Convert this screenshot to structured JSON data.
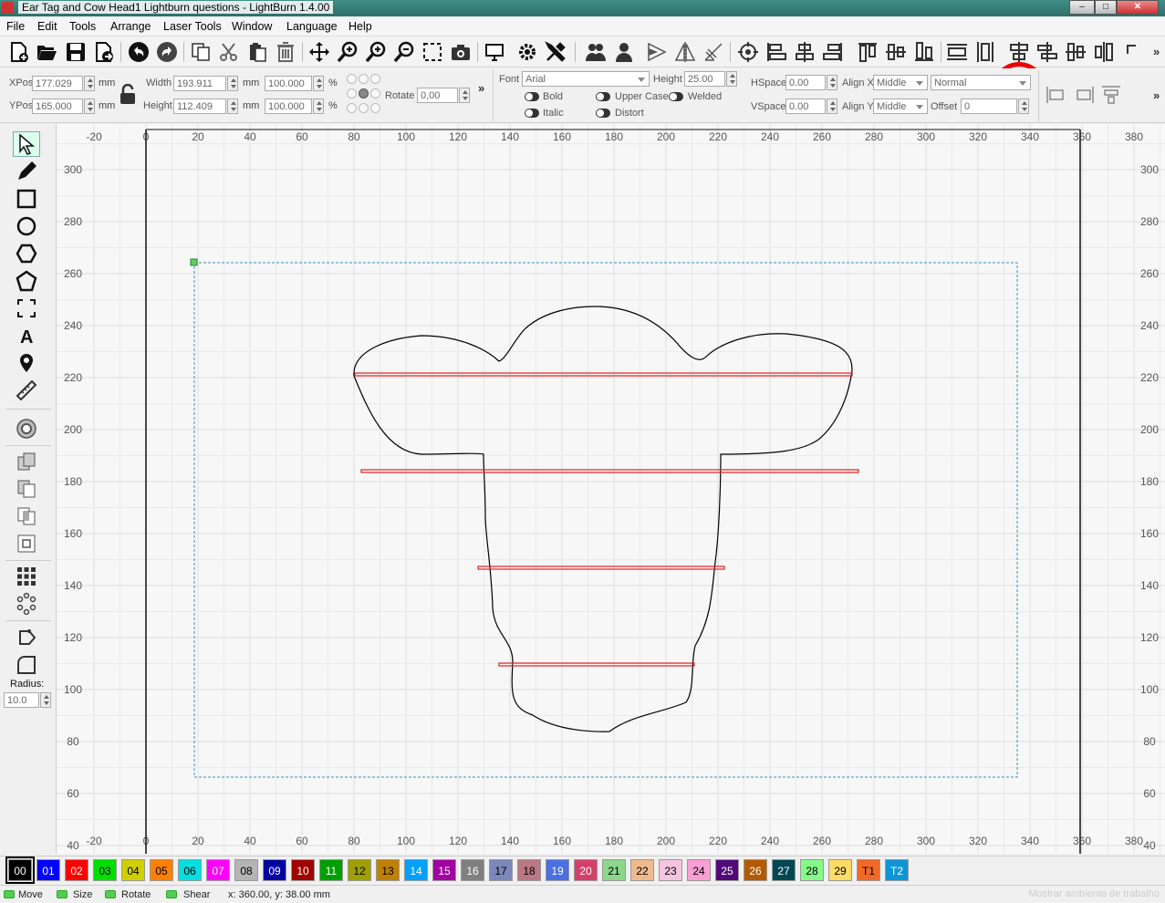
{
  "window": {
    "title": "Ear Tag and Cow Head1 Lightburn questions - LightBurn 1.4.00",
    "minimize": "–",
    "maximize": "□",
    "close": "✕"
  },
  "menu": [
    "File",
    "Edit",
    "Tools",
    "Arrange",
    "Laser Tools",
    "Window",
    "Language",
    "Help"
  ],
  "toolbar": {
    "icons": [
      "new-file-icon",
      "open-folder-icon",
      "save-icon",
      "export-icon",
      "undo-icon",
      "redo-icon",
      "copy-icon",
      "cut-icon",
      "paste-icon",
      "delete-icon",
      "move-icon",
      "zoom-in-icon",
      "zoom-in-2-icon",
      "zoom-out-icon",
      "zoom-frame-icon",
      "camera-icon",
      "monitor-icon",
      "settings-gear-icon",
      "tools-icon",
      "group-icon",
      "ungroup-icon",
      "flip-horizontal-icon",
      "mirror-icon",
      "rotate-icon",
      "center-icon",
      "align-left-icon",
      "align-center-icon",
      "align-right-icon",
      "align-top-icon",
      "align-middle-icon",
      "align-bottom-icon",
      "distribute-h-icon",
      "distribute-v-icon",
      "center-vertical-icon",
      "align-h-center-icon",
      "align-v-middle-icon",
      "distribute-spacing-icon",
      "corner-icon"
    ],
    "more": "»",
    "highlight_color": "#e00000"
  },
  "props": {
    "xpos_label": "XPos",
    "xpos": "177.029",
    "ypos_label": "YPos",
    "ypos": "165.000",
    "mm": "mm",
    "width_label": "Width",
    "width": "193.911",
    "height_label": "Height",
    "height": "112.409",
    "width_pct": "100.000",
    "height_pct": "100.000",
    "pct": "%",
    "rotate_label": "Rotate",
    "rotate": "0,00",
    "more": "»",
    "font_label": "Font",
    "font": "Arial",
    "text_height_label": "Height",
    "text_height": "25.00",
    "hspace_label": "HSpace",
    "hspace": "0.00",
    "vspace_label": "VSpace",
    "vspace": "0.00",
    "alignx_label": "Align X",
    "alignx": "Middle",
    "aligny_label": "Align Y",
    "aligny": "Middle",
    "style": "Normal",
    "offset_label": "Offset",
    "offset": "0",
    "bold": "Bold",
    "italic": "Italic",
    "uppercase": "Upper Case",
    "welded": "Welded",
    "distort": "Distort",
    "more2": "»"
  },
  "lefttools": {
    "radius_label": "Radius:",
    "radius": "10.0"
  },
  "canvas": {
    "x_ticks": [
      "-20",
      "0",
      "20",
      "40",
      "60",
      "80",
      "100",
      "120",
      "140",
      "160",
      "180",
      "200",
      "220",
      "240",
      "260",
      "280",
      "300",
      "320",
      "340",
      "360",
      "380"
    ],
    "y_ticks": [
      "300",
      "280",
      "260",
      "240",
      "220",
      "200",
      "180",
      "160",
      "140",
      "120",
      "100",
      "80",
      "60",
      "40"
    ],
    "shape_color": "#000000",
    "line_color": "#e02020",
    "selection_color": "#3a8fc0"
  },
  "palette": [
    {
      "label": "00",
      "color": "#000000",
      "text": "#ffffff"
    },
    {
      "label": "01",
      "color": "#0000ff",
      "text": "#ffffff"
    },
    {
      "label": "02",
      "color": "#ff0000",
      "text": "#ffffff"
    },
    {
      "label": "03",
      "color": "#00e000",
      "text": "#000000"
    },
    {
      "label": "04",
      "color": "#d0d000",
      "text": "#000000"
    },
    {
      "label": "05",
      "color": "#ff8000",
      "text": "#000000"
    },
    {
      "label": "06",
      "color": "#00e0e0",
      "text": "#000000"
    },
    {
      "label": "07",
      "color": "#ff00ff",
      "text": "#ffffff"
    },
    {
      "label": "08",
      "color": "#b4b4b4",
      "text": "#000000"
    },
    {
      "label": "09",
      "color": "#0000a0",
      "text": "#ffffff"
    },
    {
      "label": "10",
      "color": "#a00000",
      "text": "#ffffff"
    },
    {
      "label": "11",
      "color": "#00a000",
      "text": "#ffffff"
    },
    {
      "label": "12",
      "color": "#a0a000",
      "text": "#000000"
    },
    {
      "label": "13",
      "color": "#c08000",
      "text": "#000000"
    },
    {
      "label": "14",
      "color": "#00a0ff",
      "text": "#ffffff"
    },
    {
      "label": "15",
      "color": "#a000a0",
      "text": "#ffffff"
    },
    {
      "label": "16",
      "color": "#808080",
      "text": "#ffffff"
    },
    {
      "label": "17",
      "color": "#7d87b9",
      "text": "#000000"
    },
    {
      "label": "18",
      "color": "#bb7784",
      "text": "#000000"
    },
    {
      "label": "19",
      "color": "#4a6fe3",
      "text": "#ffffff"
    },
    {
      "label": "20",
      "color": "#d33f6a",
      "text": "#ffffff"
    },
    {
      "label": "21",
      "color": "#8cd78c",
      "text": "#000000"
    },
    {
      "label": "22",
      "color": "#f0b98d",
      "text": "#000000"
    },
    {
      "label": "23",
      "color": "#f6c4e1",
      "text": "#000000"
    },
    {
      "label": "24",
      "color": "#fa9ed4",
      "text": "#000000"
    },
    {
      "label": "25",
      "color": "#500a78",
      "text": "#ffffff"
    },
    {
      "label": "26",
      "color": "#b45a00",
      "text": "#ffffff"
    },
    {
      "label": "27",
      "color": "#004754",
      "text": "#ffffff"
    },
    {
      "label": "28",
      "color": "#86fa88",
      "text": "#000000"
    },
    {
      "label": "29",
      "color": "#ffdb66",
      "text": "#000000"
    },
    {
      "label": "T1",
      "color": "#f36926",
      "text": "#000000"
    },
    {
      "label": "T2",
      "color": "#0c96d9",
      "text": "#ffffff"
    }
  ],
  "status": {
    "move": "Move",
    "size": "Size",
    "rotate": "Rotate",
    "shear": "Shear",
    "coords": "x: 360.00, y: 38.00 mm",
    "watermark": "Mostrar ambiente de trabalho"
  }
}
